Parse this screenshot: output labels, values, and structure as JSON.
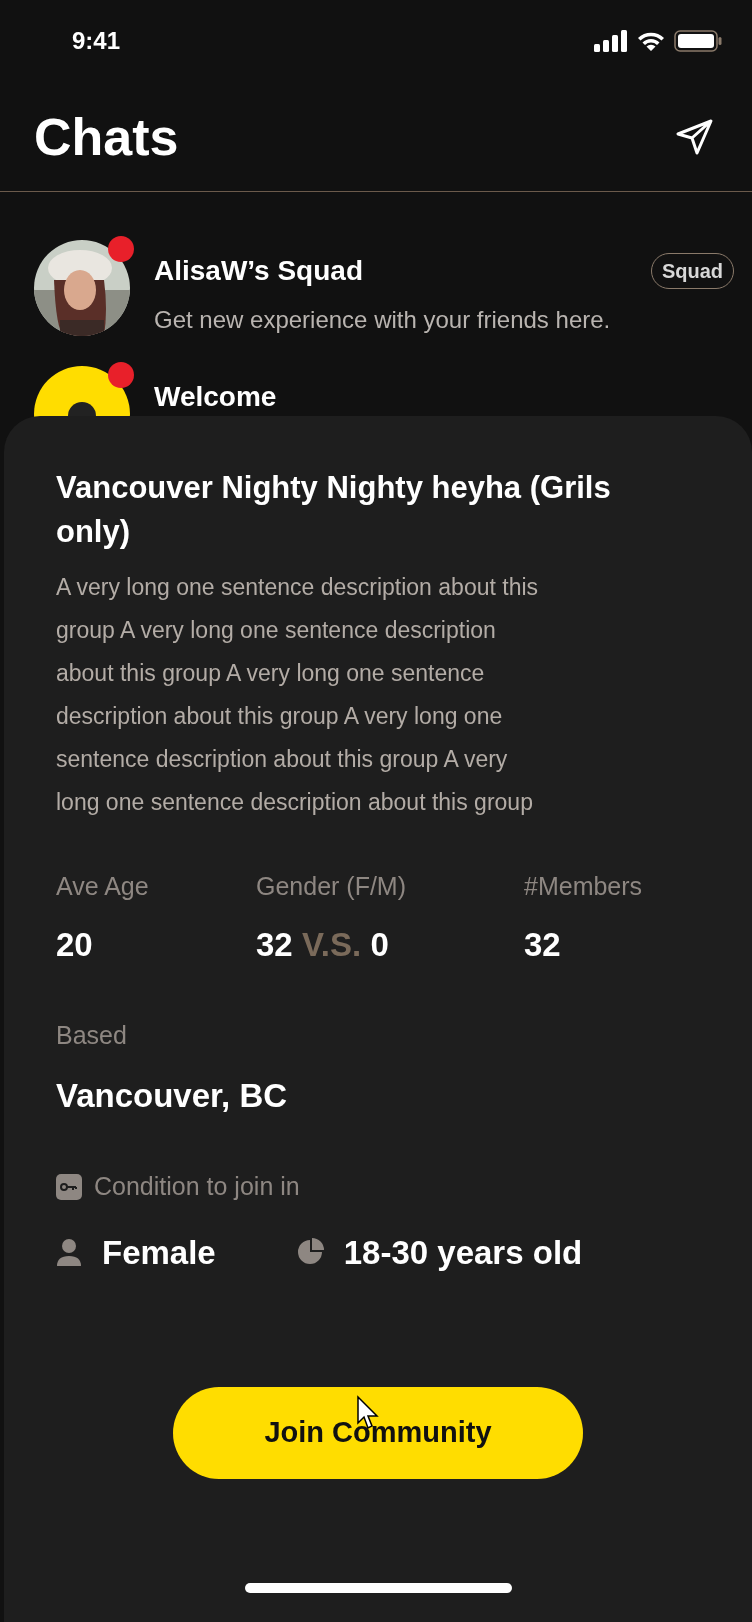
{
  "status_bar": {
    "time": "9:41"
  },
  "header": {
    "title": "Chats"
  },
  "chats": [
    {
      "name": "AlisaW’s Squad",
      "message": "Get new experience with your friends here.",
      "badge": "Squad",
      "unread": true
    },
    {
      "name": "Welcome",
      "unread": true,
      "avatar": {
        "kind": "logo"
      }
    }
  ],
  "sheet": {
    "title": "Vancouver Nighty Nighty heyha (Grils only)",
    "description": "A very long one sentence description about this group A very long one sentence description about this group A very long one sentence description about this group A very long one sentence description about this group A very long one sentence description about this group",
    "stats": [
      {
        "label": "Ave Age",
        "kind": "single",
        "value": "20"
      },
      {
        "label": "Gender (F/M)",
        "kind": "versus",
        "female": "32",
        "separator": "V.S.",
        "male": "0"
      },
      {
        "label": "#Members",
        "kind": "single",
        "value": "32"
      }
    ],
    "based_label": "Based",
    "based_value": "Vancouver, BC",
    "condition_label": "Condition to join in",
    "conditions": [
      {
        "kind": "gender",
        "text": "Female"
      },
      {
        "kind": "age",
        "text": "18-30 years old"
      }
    ],
    "button": "Join Community"
  }
}
